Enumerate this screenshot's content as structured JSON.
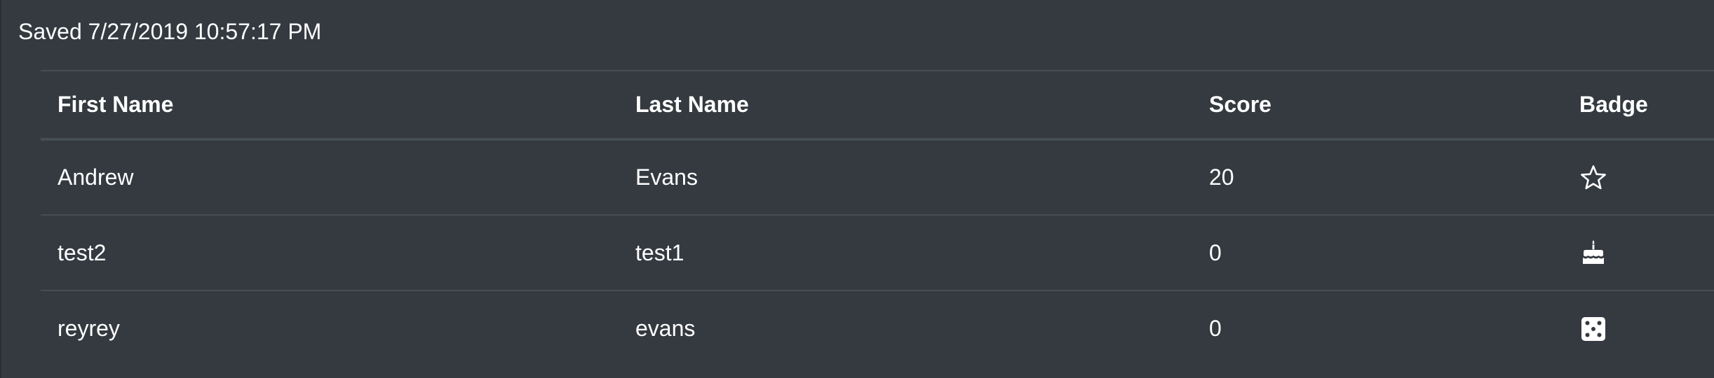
{
  "status": {
    "saved_text": "Saved 7/27/2019 10:57:17 PM"
  },
  "table": {
    "headers": {
      "first_name": "First Name",
      "last_name": "Last Name",
      "score": "Score",
      "badge": "Badge"
    },
    "rows": [
      {
        "first_name": "Andrew",
        "last_name": "Evans",
        "score": "20",
        "badge_icon": "star-outline-icon"
      },
      {
        "first_name": "test2",
        "last_name": "test1",
        "score": "0",
        "badge_icon": "birthday-cake-icon"
      },
      {
        "first_name": "reyrey",
        "last_name": "evans",
        "score": "0",
        "badge_icon": "dice-icon"
      }
    ]
  },
  "colors": {
    "background": "#343a40",
    "border": "#454d55",
    "text": "#ffffff"
  }
}
